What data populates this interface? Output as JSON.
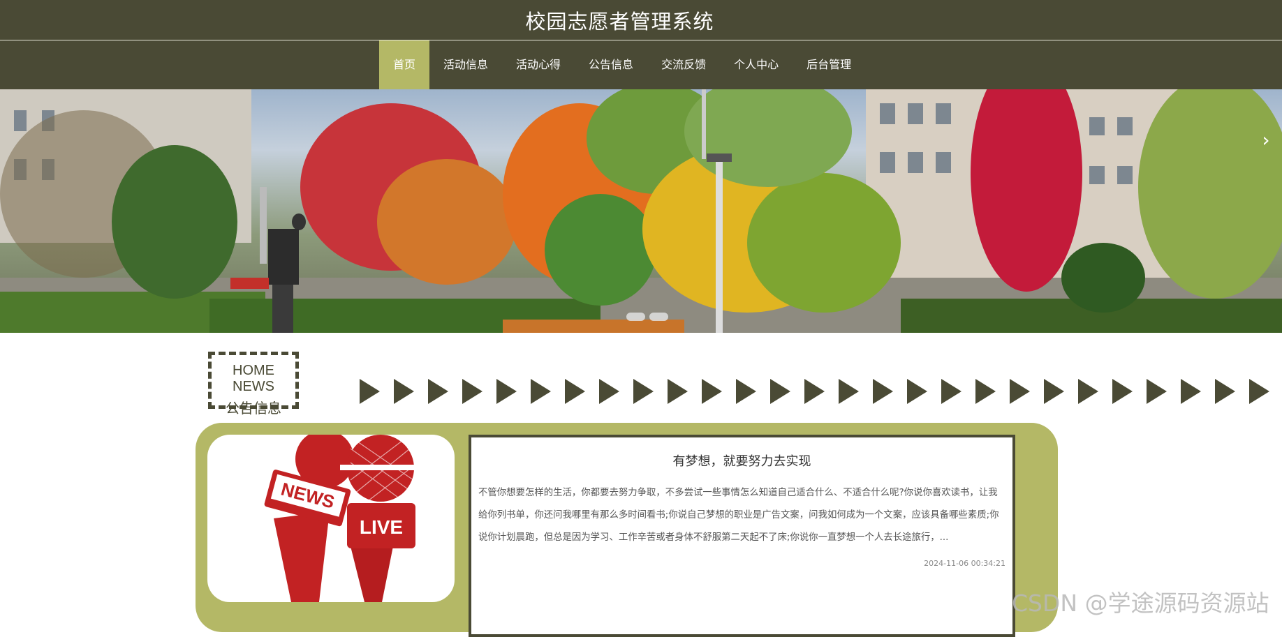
{
  "site": {
    "title": "校园志愿者管理系统"
  },
  "nav": {
    "items": [
      {
        "label": "首页",
        "active": true
      },
      {
        "label": "活动信息",
        "active": false
      },
      {
        "label": "活动心得",
        "active": false
      },
      {
        "label": "公告信息",
        "active": false
      },
      {
        "label": "交流反馈",
        "active": false
      },
      {
        "label": "个人中心",
        "active": false
      },
      {
        "label": "后台管理",
        "active": false
      }
    ]
  },
  "banner": {
    "next_icon": "chevron-right-icon",
    "slide_count": 2
  },
  "section": {
    "title_en": "HOME NEWS",
    "title_cn": "公告信息"
  },
  "news": {
    "image_text": {
      "news": "NEWS",
      "live": "LIVE"
    },
    "title": "有梦想，就要努力去实现",
    "body": "不管你想要怎样的生活，你都要去努力争取，不多尝试一些事情怎么知道自己适合什么、不适合什么呢?你说你喜欢读书，让我给你列书单，你还问我哪里有那么多时间看书;你说自己梦想的职业是广告文案，问我如何成为一个文案，应该具备哪些素质;你说你计划晨跑，但总是因为学习、工作辛苦或者身体不舒服第二天起不了床;你说你一直梦想一个人去长途旅行，...",
    "date": "2024-11-06 00:34:21"
  },
  "watermark": "CSDN @学途源码资源站",
  "colors": {
    "primary": "#4a4a35",
    "accent": "#b4b866",
    "text": "#333333"
  }
}
